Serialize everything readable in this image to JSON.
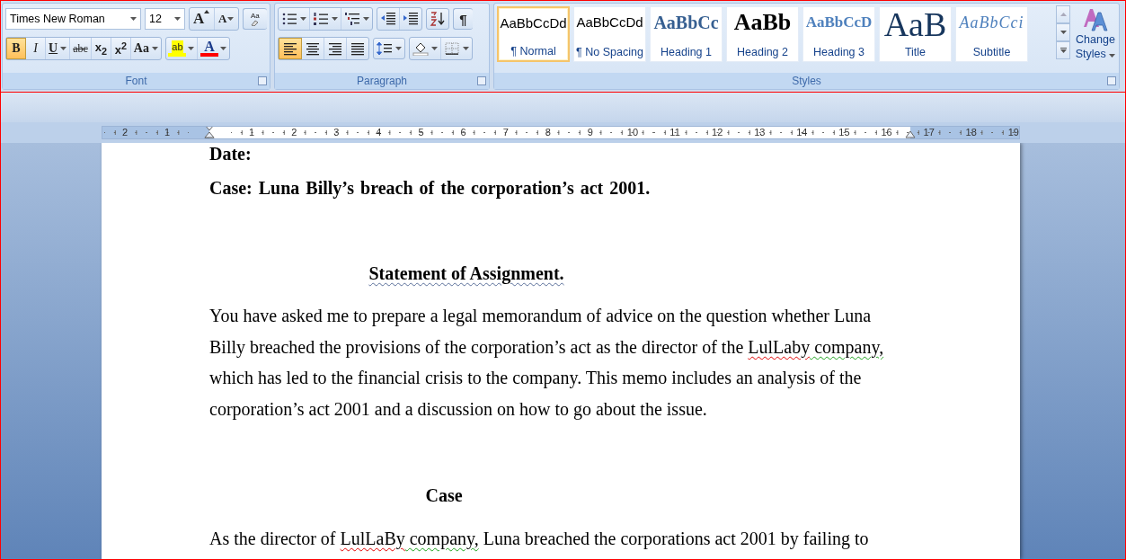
{
  "ribbon": {
    "font_group": {
      "label": "Font",
      "font_name": "Times New Roman",
      "font_size": "12",
      "row1_buttons": [
        {
          "kind": "grow_font",
          "label": "A"
        },
        {
          "kind": "shrink_font",
          "label": "A"
        },
        {
          "kind": "clear_formatting",
          "label": "Aa"
        }
      ],
      "row2_buttons": [
        {
          "kind": "bold",
          "label": "B",
          "selected": true,
          "dropdown": false
        },
        {
          "kind": "italic",
          "label": "I",
          "selected": false,
          "dropdown": false
        },
        {
          "kind": "underline",
          "label": "U",
          "selected": false,
          "dropdown": true
        },
        {
          "kind": "strikethrough",
          "label": "abc",
          "selected": false,
          "dropdown": false
        },
        {
          "kind": "subscript",
          "label": "x$_{2}$",
          "selected": false,
          "dropdown": false
        },
        {
          "kind": "superscript",
          "label": "x$^{2}$",
          "selected": false,
          "dropdown": false
        },
        {
          "kind": "change_case",
          "label": "Aa",
          "selected": false,
          "dropdown": true
        }
      ],
      "color_buttons": [
        {
          "kind": "highlight",
          "label": "ab",
          "color": "#ffff00"
        },
        {
          "kind": "font_color",
          "label": "A",
          "color": "#ff0000"
        }
      ]
    },
    "paragraph_group": {
      "label": "Paragraph",
      "row1_buttons": [
        {
          "kind": "bullets",
          "dropdown": true,
          "selected": false
        },
        {
          "kind": "numbering",
          "dropdown": true,
          "selected": false
        },
        {
          "kind": "multilevel",
          "dropdown": true,
          "selected": false
        },
        {
          "kind": "decrease_indent",
          "dropdown": false,
          "selected": false
        },
        {
          "kind": "increase_indent",
          "dropdown": false,
          "selected": false
        },
        {
          "kind": "sort",
          "dropdown": false,
          "selected": false
        },
        {
          "kind": "show_marks",
          "label": "¶",
          "dropdown": false,
          "selected": false
        }
      ],
      "row2_buttons": [
        {
          "kind": "align_left",
          "dropdown": false,
          "selected": true
        },
        {
          "kind": "align_center",
          "dropdown": false,
          "selected": false
        },
        {
          "kind": "align_right",
          "dropdown": false,
          "selected": false
        },
        {
          "kind": "justify",
          "dropdown": false,
          "selected": false
        },
        {
          "kind": "line_spacing",
          "dropdown": true,
          "selected": false
        },
        {
          "kind": "shading",
          "dropdown": true,
          "selected": false
        },
        {
          "kind": "borders",
          "dropdown": true,
          "selected": false
        }
      ]
    },
    "styles_group": {
      "label": "Styles",
      "items": [
        {
          "kind": "normal",
          "preview": "AaBbCcDd",
          "label": "¶ Normal",
          "selected": true
        },
        {
          "kind": "no_spacing",
          "preview": "AaBbCcDd",
          "label": "¶ No Spacing",
          "selected": false
        },
        {
          "kind": "heading1",
          "preview": "AaBbCc",
          "label": "Heading 1",
          "selected": false
        },
        {
          "kind": "heading2",
          "preview": "AaBb",
          "label": "Heading 2",
          "selected": false
        },
        {
          "kind": "heading3",
          "preview": "AaBbCcD",
          "label": "Heading 3",
          "selected": false
        },
        {
          "kind": "title",
          "preview": "AaB",
          "label": "Title",
          "selected": false
        },
        {
          "kind": "subtitle",
          "preview": "AaBbCci",
          "label": "Subtitle",
          "selected": false
        }
      ],
      "change_styles": {
        "label": "Change Styles"
      }
    }
  },
  "ruler": {
    "left_numbers": [
      "2",
      "1"
    ],
    "right_numbers": [
      "1",
      "2",
      "3",
      "4",
      "5",
      "6",
      "7",
      "8",
      "9",
      "10",
      "11",
      "12",
      "13",
      "14",
      "15",
      "16",
      "17",
      "18",
      "19"
    ]
  },
  "document": {
    "paragraphs": [
      {
        "kind": "bold_line",
        "runs": [
          {
            "text": "Date:"
          }
        ]
      },
      {
        "kind": "bold_line",
        "runs": [
          {
            "text": "Case: Luna Billy’s breach of the corporation’s act 2001."
          }
        ]
      },
      {
        "kind": "heading",
        "runs": [
          {
            "text": "Statement of Assignment.",
            "grammar_error": true
          }
        ]
      },
      {
        "kind": "body",
        "runs": [
          {
            "text": "You have asked me to prepare a legal memorandum of advice on the question whether Luna Billy breached the provisions of the corporation’s act as the director of the "
          },
          {
            "text": "LulLaby",
            "spelling_error": true
          },
          {
            "text": " company,",
            "grammar_error": true
          },
          {
            "text": " which has led to the financial crisis to the company. This memo includes an analysis of the corporation’s act 2001 and a discussion on how to go about the issue."
          }
        ]
      },
      {
        "kind": "heading",
        "runs": [
          {
            "text": "Case"
          }
        ]
      },
      {
        "kind": "body",
        "runs": [
          {
            "text": "As the director of "
          },
          {
            "text": "LulLaBy",
            "spelling_error": true
          },
          {
            "text": " company,",
            "grammar_error": true
          },
          {
            "text": " Luna breached the corporations act 2001 by failing to"
          }
        ]
      }
    ]
  }
}
